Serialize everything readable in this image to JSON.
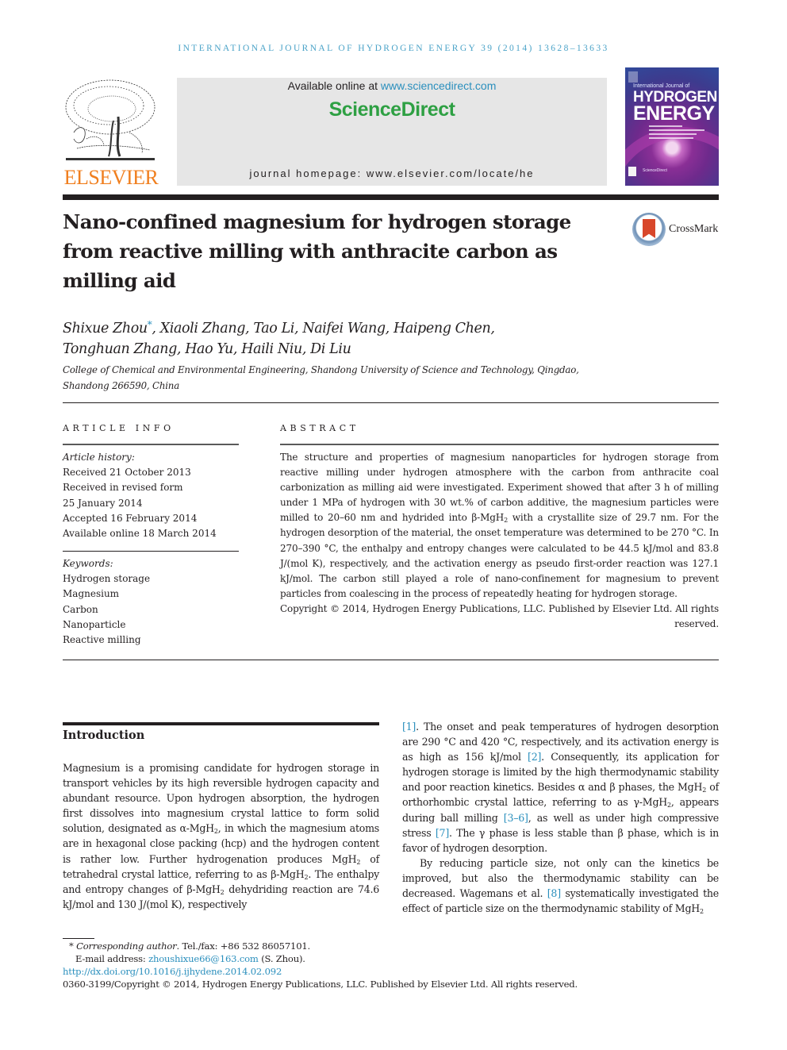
{
  "running_head": "INTERNATIONAL JOURNAL OF HYDROGEN ENERGY 39 (2014) 13628–13633",
  "masthead": {
    "publisher_logo_text": "ELSEVIER",
    "available_prefix": "Available online at ",
    "available_link": "www.sciencedirect.com",
    "brand": "ScienceDirect",
    "homepage_prefix": "journal homepage: ",
    "homepage_url": "www.elsevier.com/locate/he",
    "cover": {
      "kicker": "International Journal of",
      "title_line1": "HYDROGEN",
      "title_line2": "ENERGY",
      "footer": "ScienceDirect"
    }
  },
  "article": {
    "title": "Nano-confined magnesium for hydrogen storage from reactive milling with anthracite carbon as milling aid",
    "crossmark_label": "CrossMark",
    "authors_line1_first": "Shixue Zhou",
    "corresponding_mark": "*",
    "authors_line1_rest": ", Xiaoli Zhang, Tao Li, Naifei Wang, Haipeng Chen,",
    "authors_line2": "Tonghuan Zhang, Hao Yu, Haili Niu, Di Liu",
    "affiliation_line1": "College of Chemical and Environmental Engineering, Shandong University of Science and Technology, Qingdao,",
    "affiliation_line2": "Shandong 266590, China"
  },
  "article_info": {
    "heading": "ARTICLE INFO",
    "history_label": "Article history:",
    "history": [
      "Received 21 October 2013",
      "Received in revised form",
      "25 January 2014",
      "Accepted 16 February 2014",
      "Available online 18 March 2014"
    ],
    "keywords_label": "Keywords:",
    "keywords": [
      "Hydrogen storage",
      "Magnesium",
      "Carbon",
      "Nanoparticle",
      "Reactive milling"
    ]
  },
  "abstract": {
    "heading": "ABSTRACT",
    "text_part1": "The structure and properties of magnesium nanoparticles for hydrogen storage from reactive milling under hydrogen atmosphere with the carbon from anthracite coal carbonization as milling aid were investigated. Experiment showed that after 3 h of milling under 1 MPa of hydrogen with 30 wt.% of carbon additive, the magnesium particles were milled to 20–60 nm and hydrided into β-MgH",
    "text_part2": " with a crystallite size of 29.7 nm. For the hydrogen desorption of the material, the onset temperature was determined to be 270 °C. In 270–390 °C, the enthalpy and entropy changes were calculated to be 44.5 kJ/mol and 83.8 J/(mol K), respectively, and the activation energy as pseudo first-order reaction was 127.1 kJ/mol. The carbon still played a role of nano-confinement for magnesium to prevent particles from coalescing in the process of repeatedly heating for hydrogen storage.",
    "copyright": "Copyright © 2014, Hydrogen Energy Publications, LLC. Published by Elsevier Ltd. All rights reserved."
  },
  "introduction": {
    "heading": "Introduction",
    "left_column": {
      "s1": "Magnesium is a promising candidate for hydrogen storage in transport vehicles by its high reversible hydrogen capacity and abundant resource. Upon hydrogen absorption, the hydrogen first dissolves into magnesium crystal lattice to form solid solution, designated as α-MgH",
      "s2": ", in which the magnesium atoms are in hexagonal close packing (hcp) and the hydrogen content is rather low. Further hydrogenation produces MgH",
      "s3": " of tetrahedral crystal lattice, referring to as β-MgH",
      "s4": ". The enthalpy and entropy changes of β-MgH",
      "s5": " dehy­driding reaction are 74.6 kJ/mol and 130 J/(mol K), respectively"
    },
    "right_column": {
      "ref1": "[1]",
      "p1a": ". The onset and peak temperatures of hydrogen desorption are 290 °C and 420 °C, respectively, and its activation energy is as high as 156 kJ/mol ",
      "ref2": "[2]",
      "p1b": ". Consequently, its application for hydrogen storage is limited by the high thermodynamic sta­bility and poor reaction kinetics. Besides α and β phases, the MgH",
      "p1c": " of orthorhombic crystal lattice, referring to as γ-MgH",
      "p1d": ", appears during ball milling ",
      "ref3": "[3–6]",
      "p1e": ", as well as under high compressive stress ",
      "ref4": "[7]",
      "p1f": ". The γ phase is less stable than β phase, which is in favor of hydrogen desorption.",
      "p2a": "By reducing particle size, not only can the kinetics be improved, but also the thermodynamic stability can be decreased. Wagemans et al. ",
      "ref5": "[8]",
      "p2b": " systematically investigated the effect of particle size on the thermodynamic stability of MgH",
      "sub2": "2"
    }
  },
  "footnotes": {
    "mark": "*",
    "corresponding_label": "Corresponding author",
    "tel": ". Tel./fax: +86 532 86057101.",
    "email_label": "E-mail address: ",
    "email": "zhoushixue66@163.com",
    "email_suffix": " (S. Zhou).",
    "doi": "http://dx.doi.org/10.1016/j.ijhydene.2014.02.092",
    "issn_copyright": "0360-3199/Copyright © 2014, Hydrogen Energy Publications, LLC. Published by Elsevier Ltd. All rights reserved."
  },
  "colors": {
    "link": "#2a8fbd",
    "running_head": "#4ba3c8",
    "elsevier_orange": "#f07f1f",
    "sciencedirect_green": "#2ea043",
    "masthead_bg": "#e6e6e6"
  }
}
